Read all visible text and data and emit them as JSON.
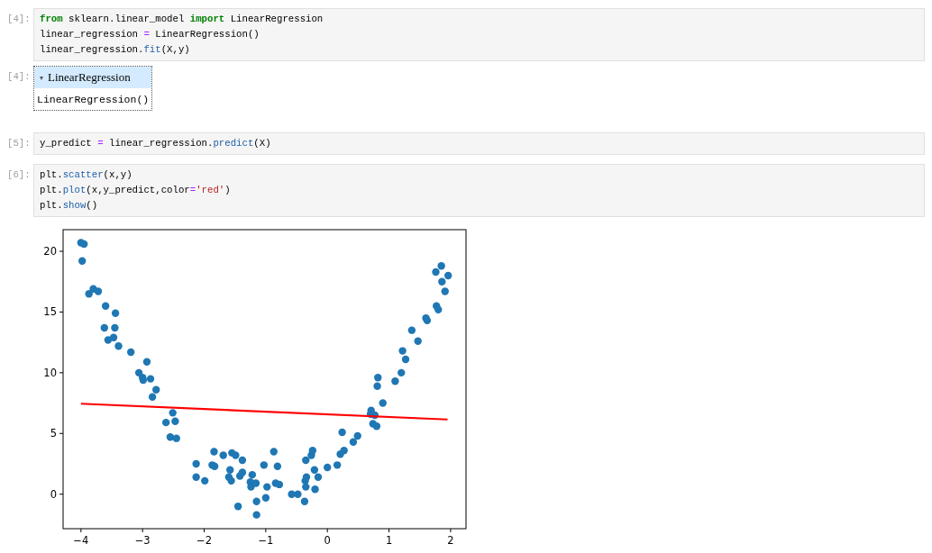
{
  "cells": [
    {
      "kind": "code",
      "prompt": "[4]:",
      "lines": [
        [
          {
            "kind": "keyword",
            "text": "from"
          },
          {
            "kind": "name",
            "text": " sklearn.linear_model "
          },
          {
            "kind": "keyword",
            "text": "import"
          },
          {
            "kind": "name",
            "text": " LinearRegression"
          }
        ],
        [
          {
            "kind": "name",
            "text": "linear_regression "
          },
          {
            "kind": "operator",
            "text": "="
          },
          {
            "kind": "name",
            "text": " LinearRegression()"
          }
        ],
        [
          {
            "kind": "name",
            "text": "linear_regression."
          },
          {
            "kind": "call",
            "text": "fit"
          },
          {
            "kind": "name",
            "text": "(X,y)"
          }
        ]
      ]
    },
    {
      "kind": "estimator",
      "prompt": "[4]:",
      "toggle": "▾",
      "name": "LinearRegression",
      "repr": "LinearRegression()"
    },
    {
      "kind": "code",
      "prompt": "[5]:",
      "lines": [
        [
          {
            "kind": "name",
            "text": "y_predict "
          },
          {
            "kind": "operator",
            "text": "="
          },
          {
            "kind": "name",
            "text": " linear_regression."
          },
          {
            "kind": "call",
            "text": "predict"
          },
          {
            "kind": "name",
            "text": "(X)"
          }
        ]
      ]
    },
    {
      "kind": "code",
      "prompt": "[6]:",
      "lines": [
        [
          {
            "kind": "name",
            "text": "plt."
          },
          {
            "kind": "call",
            "text": "scatter"
          },
          {
            "kind": "name",
            "text": "(x,y)"
          }
        ],
        [
          {
            "kind": "name",
            "text": "plt."
          },
          {
            "kind": "call",
            "text": "plot"
          },
          {
            "kind": "name",
            "text": "(x,y_predict,color"
          },
          {
            "kind": "operator",
            "text": "="
          },
          {
            "kind": "string",
            "text": "'red'"
          },
          {
            "kind": "name",
            "text": ")"
          }
        ],
        [
          {
            "kind": "name",
            "text": "plt."
          },
          {
            "kind": "call",
            "text": "show"
          },
          {
            "kind": "name",
            "text": "()"
          }
        ]
      ]
    },
    {
      "kind": "plot",
      "chart_data": {
        "type": "scatter",
        "xlim": [
          -4.29,
          2.25
        ],
        "ylim": [
          -2.84,
          21.78
        ],
        "xticks": [
          {
            "value": -4,
            "label": "−4"
          },
          {
            "value": -3,
            "label": "−3"
          },
          {
            "value": -2,
            "label": "−2"
          },
          {
            "value": -1,
            "label": "−1"
          },
          0,
          1,
          2
        ],
        "yticks": [
          0,
          5,
          10,
          15,
          20
        ],
        "series": [
          {
            "type": "scatter",
            "color": "#1f77b4",
            "x": [
              -4.0,
              -3.95,
              -3.98,
              -3.87,
              -3.8,
              -3.72,
              -3.6,
              -3.62,
              -3.56,
              -3.47,
              -3.45,
              -3.44,
              -3.39,
              -3.19,
              -3.06,
              -3.0,
              -2.99,
              -2.93,
              -2.87,
              -2.84,
              -2.78,
              -2.62,
              -2.55,
              -2.51,
              -2.47,
              -2.45,
              -2.13,
              -2.13,
              -1.99,
              -1.87,
              -1.83,
              -1.84,
              -1.69,
              -1.6,
              -1.58,
              -1.56,
              -1.55,
              -1.49,
              -1.45,
              -1.42,
              -1.38,
              -1.38,
              -1.25,
              -1.24,
              -1.22,
              -1.16,
              -1.15,
              -1.15,
              -1.03,
              -1.0,
              -0.98,
              -0.87,
              -0.84,
              -0.81,
              -0.78,
              -0.58,
              -0.48,
              -0.37,
              -0.36,
              -0.35,
              -0.35,
              -0.34,
              -0.26,
              -0.24,
              -0.21,
              -0.2,
              -0.15,
              0.0,
              0.16,
              0.21,
              0.24,
              0.27,
              0.42,
              0.49,
              0.7,
              0.71,
              0.74,
              0.77,
              0.8,
              0.81,
              0.82,
              0.9,
              1.1,
              1.2,
              1.22,
              1.27,
              1.37,
              1.47,
              1.6,
              1.62,
              1.77,
              1.8,
              1.76,
              1.85,
              1.86,
              1.91,
              1.96
            ],
            "values": [
              20.7,
              20.6,
              19.2,
              16.5,
              16.9,
              16.7,
              15.5,
              13.7,
              12.7,
              12.9,
              13.7,
              14.9,
              12.2,
              11.7,
              10.0,
              9.6,
              9.4,
              10.9,
              9.5,
              8.0,
              8.6,
              5.9,
              4.7,
              6.7,
              6.0,
              4.6,
              2.5,
              1.4,
              1.1,
              2.4,
              2.3,
              3.5,
              3.2,
              1.4,
              2.0,
              1.1,
              3.4,
              3.2,
              -1.0,
              1.5,
              1.8,
              2.8,
              1.0,
              0.6,
              1.6,
              0.9,
              -0.6,
              -1.7,
              2.4,
              -0.3,
              0.6,
              3.5,
              0.9,
              2.3,
              0.8,
              0.0,
              0.0,
              -0.6,
              1.1,
              0.6,
              2.8,
              1.4,
              3.2,
              3.6,
              2.0,
              0.4,
              1.4,
              2.2,
              2.4,
              3.3,
              5.1,
              3.6,
              4.3,
              4.8,
              6.6,
              6.9,
              5.8,
              6.5,
              5.6,
              8.9,
              9.6,
              7.5,
              9.3,
              10.0,
              11.8,
              11.1,
              13.5,
              12.6,
              14.5,
              14.3,
              15.5,
              15.2,
              18.3,
              18.8,
              17.5,
              16.7,
              18.0
            ]
          },
          {
            "type": "line",
            "color": "#ff0000",
            "x": [
              -4.0,
              1.95
            ],
            "values": [
              7.45,
              6.15
            ]
          }
        ]
      }
    }
  ]
}
